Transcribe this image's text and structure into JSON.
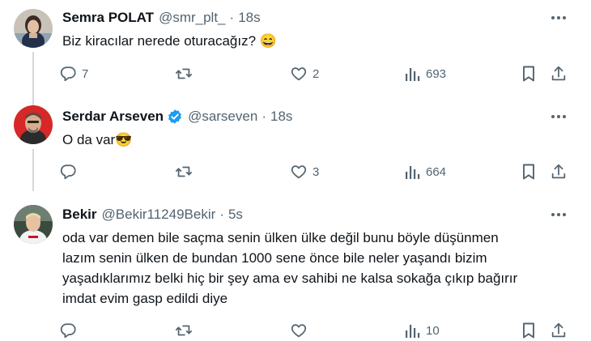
{
  "tweets": [
    {
      "name": "Semra POLAT",
      "handle": "@smr_plt_",
      "separator": "·",
      "time": "18s",
      "verified": false,
      "text": "Biz kiracılar nerede oturacağız?",
      "emoji": "😄",
      "replies": "7",
      "retweets": "",
      "likes": "2",
      "views": "693"
    },
    {
      "name": "Serdar Arseven",
      "handle": "@sarseven",
      "separator": "·",
      "time": "18s",
      "verified": true,
      "text": "O da var",
      "emoji": "😎",
      "replies": "",
      "retweets": "",
      "likes": "3",
      "views": "664"
    },
    {
      "name": "Bekir",
      "handle": "@Bekir11249Bekir",
      "separator": "·",
      "time": "5s",
      "verified": false,
      "lines": [
        "oda var demen bile saçma senin ülken ülke değil bunu böyle düşünmen",
        "lazım senin ülken de bundan 1000 sene önce bile neler yaşandı bizim",
        "yaşadıklarımız belki hiç bir şey ama ev sahibi ne kalsa sokağa çıkıp bağırır",
        "imdat evim gasp edildi diye"
      ],
      "replies": "",
      "retweets": "",
      "likes": "",
      "views": "10"
    }
  ],
  "colors": {
    "text": "#0f1419",
    "secondary": "#536471",
    "thread_line": "#cfd9de",
    "verified": "#1d9bf0"
  },
  "icons": [
    "reply-icon",
    "retweet-icon",
    "like-icon",
    "views-icon",
    "bookmark-icon",
    "share-icon",
    "more-icon",
    "verified-badge-icon"
  ]
}
